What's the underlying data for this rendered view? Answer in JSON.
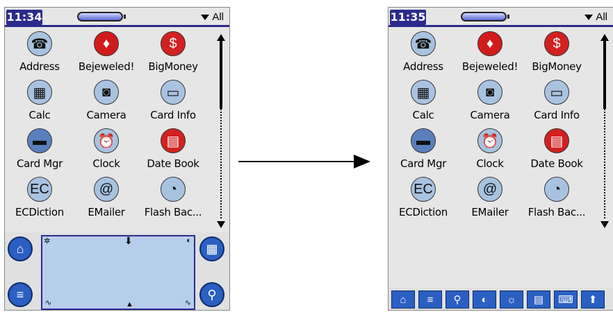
{
  "left": {
    "time": "11:34",
    "category": "All",
    "apps": [
      {
        "label": "Address",
        "icon": "phone-icon",
        "glyph": "☎",
        "color": "#a8c3e0"
      },
      {
        "label": "Bejeweled!",
        "icon": "gem-icon",
        "glyph": "♦",
        "color": "#d11b1b"
      },
      {
        "label": "BigMoney",
        "icon": "dollar-icon",
        "glyph": "$",
        "color": "#d32020"
      },
      {
        "label": "Calc",
        "icon": "calculator-icon",
        "glyph": "▦",
        "color": "#a8c3e0"
      },
      {
        "label": "Camera",
        "icon": "camera-icon",
        "glyph": "◙",
        "color": "#a8c3e0"
      },
      {
        "label": "Card Info",
        "icon": "card-info-icon",
        "glyph": "▭",
        "color": "#a8c3e0"
      },
      {
        "label": "Card Mgr",
        "icon": "card-manager-icon",
        "glyph": "▬",
        "color": "#5a7fbf"
      },
      {
        "label": "Clock",
        "icon": "alarm-clock-icon",
        "glyph": "⏰",
        "color": "#a8c3e0"
      },
      {
        "label": "Date Book",
        "icon": "date-book-icon",
        "glyph": "▤",
        "color": "#d32020"
      },
      {
        "label": "ECDiction",
        "icon": "dictionary-icon",
        "glyph": "EC",
        "color": "#a8c3e0"
      },
      {
        "label": "EMailer",
        "icon": "email-icon",
        "glyph": "@",
        "color": "#a8c3e0"
      },
      {
        "label": "Flash Bac...",
        "icon": "flash-backup-icon",
        "glyph": "◔",
        "color": "#a8c3e0"
      }
    ],
    "graffiti": {
      "home": "⌂",
      "menu": "≡",
      "apps": "▦",
      "find": "⚲"
    }
  },
  "right": {
    "time": "11:35",
    "category": "All",
    "apps": [
      {
        "label": "Address",
        "icon": "phone-icon",
        "glyph": "☎",
        "color": "#a8c3e0"
      },
      {
        "label": "Bejeweled!",
        "icon": "gem-icon",
        "glyph": "♦",
        "color": "#d11b1b"
      },
      {
        "label": "BigMoney",
        "icon": "dollar-icon",
        "glyph": "$",
        "color": "#d32020"
      },
      {
        "label": "Calc",
        "icon": "calculator-icon",
        "glyph": "▦",
        "color": "#a8c3e0"
      },
      {
        "label": "Camera",
        "icon": "camera-icon",
        "glyph": "◙",
        "color": "#a8c3e0"
      },
      {
        "label": "Card Info",
        "icon": "card-info-icon",
        "glyph": "▭",
        "color": "#a8c3e0"
      },
      {
        "label": "Card Mgr",
        "icon": "card-manager-icon",
        "glyph": "▬",
        "color": "#5a7fbf"
      },
      {
        "label": "Clock",
        "icon": "alarm-clock-icon",
        "glyph": "⏰",
        "color": "#a8c3e0"
      },
      {
        "label": "Date Book",
        "icon": "date-book-icon",
        "glyph": "▤",
        "color": "#d32020"
      },
      {
        "label": "ECDiction",
        "icon": "dictionary-icon",
        "glyph": "EC",
        "color": "#a8c3e0"
      },
      {
        "label": "EMailer",
        "icon": "email-icon",
        "glyph": "@",
        "color": "#a8c3e0"
      },
      {
        "label": "Flash Bac...",
        "icon": "flash-backup-icon",
        "glyph": "◔",
        "color": "#a8c3e0"
      }
    ],
    "dock": [
      {
        "icon": "home-icon",
        "glyph": "⌂"
      },
      {
        "icon": "menu-icon",
        "glyph": "≡"
      },
      {
        "icon": "find-icon",
        "glyph": "⚲"
      },
      {
        "icon": "contrast-icon",
        "glyph": "◐"
      },
      {
        "icon": "brightness-icon",
        "glyph": "☼"
      },
      {
        "icon": "status-bar-icon",
        "glyph": "▤"
      },
      {
        "icon": "keyboard-icon",
        "glyph": "⌨"
      },
      {
        "icon": "expand-input-icon",
        "glyph": "⬆"
      }
    ]
  }
}
